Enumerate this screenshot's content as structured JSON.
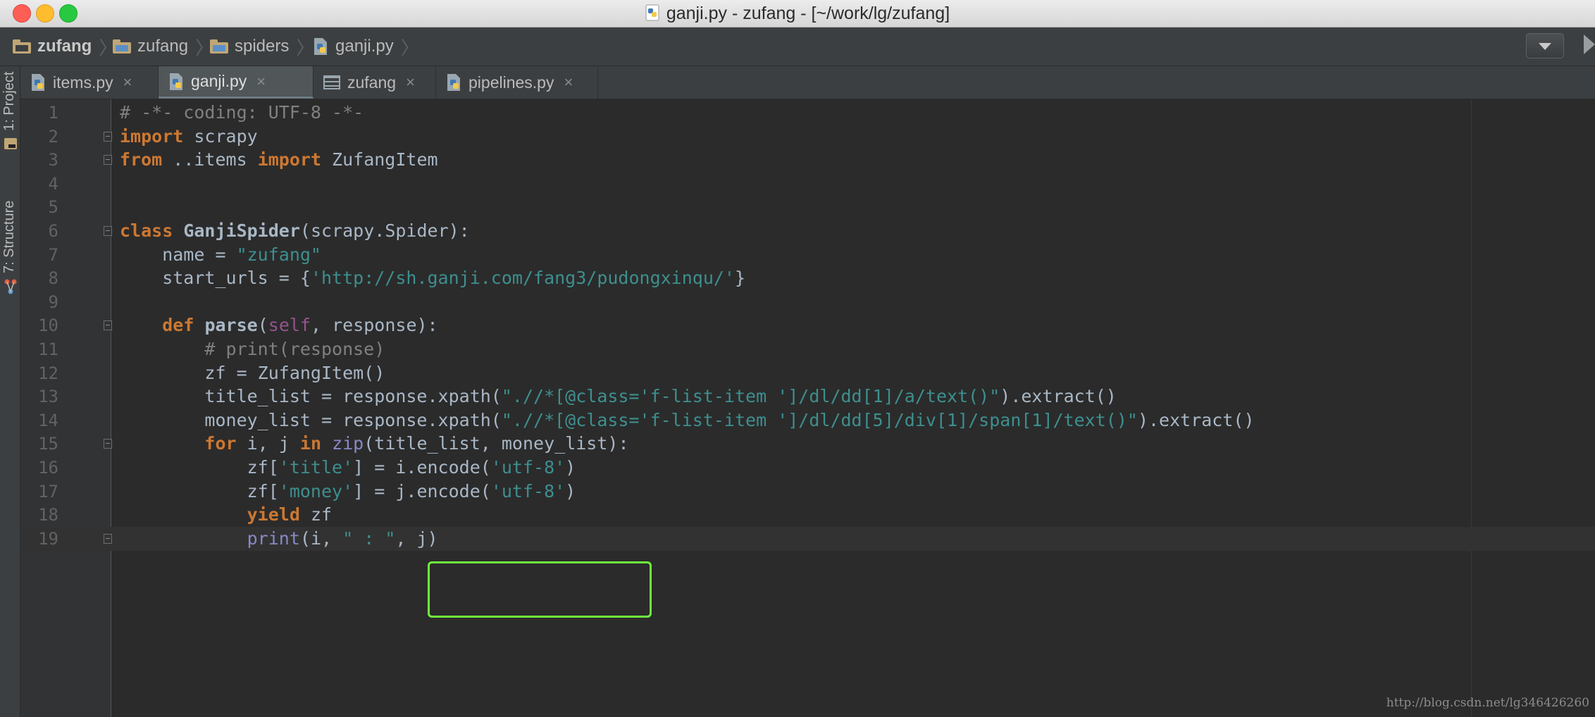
{
  "window": {
    "title": "ganji.py - zufang - [~/work/lg/zufang]"
  },
  "breadcrumb": [
    {
      "label": "zufang",
      "icon": "folder-icon",
      "bold": true
    },
    {
      "label": "zufang",
      "icon": "module-folder-icon",
      "bold": false
    },
    {
      "label": "spiders",
      "icon": "module-folder-icon",
      "bold": false
    },
    {
      "label": "ganji.py",
      "icon": "python-file-icon",
      "bold": false
    }
  ],
  "side_tools": {
    "project_label": "1: Project",
    "structure_label": "7: Structure"
  },
  "tabs": [
    {
      "label": "items.py",
      "icon": "python-file-icon",
      "active": false
    },
    {
      "label": "ganji.py",
      "icon": "python-file-icon",
      "active": true
    },
    {
      "label": "zufang",
      "icon": "table-icon",
      "active": false
    },
    {
      "label": "pipelines.py",
      "icon": "python-file-icon",
      "active": false
    }
  ],
  "tab_close_glyph": "×",
  "editor": {
    "lines": [
      "# -*- coding: UTF-8 -*-",
      "import scrapy",
      "from ..items import ZufangItem",
      "",
      "",
      "class GanjiSpider(scrapy.Spider):",
      "    name = \"zufang\"",
      "    start_urls = {'http://sh.ganji.com/fang3/pudongxinqu/'}",
      "",
      "    def parse(self, response):",
      "        # print(response)",
      "        zf = ZufangItem()",
      "        title_list = response.xpath(\".//*[@class='f-list-item ']/dl/dd[1]/a/text()\").extract()",
      "        money_list = response.xpath(\".//*[@class='f-list-item ']/dl/dd[5]/div[1]/span[1]/text()\").extract()",
      "        for i, j in zip(title_list, money_list):",
      "            zf['title'] = i.encode('utf-8')",
      "            zf['money'] = j.encode('utf-8')",
      "            yield zf",
      "            print(i, \" : \", j)"
    ],
    "highlight_box_color": "#6ef03b"
  },
  "watermark": "http://blog.csdn.net/lg346426260",
  "colors": {
    "keyword": "#cc7832",
    "comment": "#808080",
    "string": "#6a8759",
    "line_number": "#606366",
    "background": "#2b2b2b"
  }
}
